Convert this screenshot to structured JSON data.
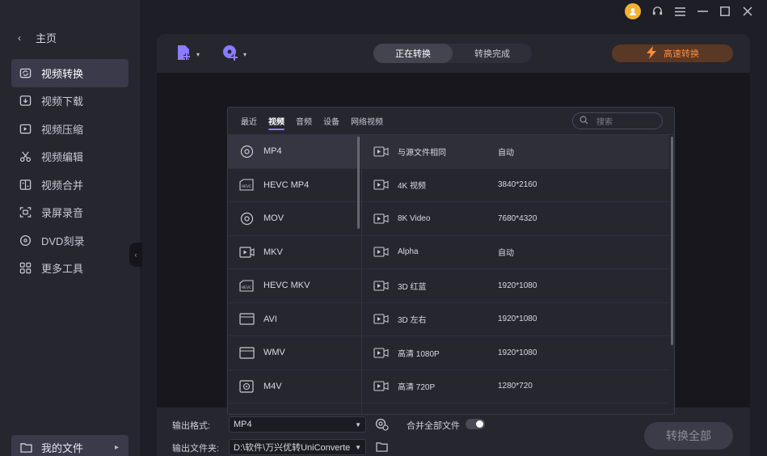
{
  "sidebar": {
    "home_label": "主页",
    "items": [
      {
        "label": "视频转换",
        "icon": "video-convert-icon"
      },
      {
        "label": "视频下载",
        "icon": "download-icon"
      },
      {
        "label": "视频压缩",
        "icon": "compress-icon"
      },
      {
        "label": "视频编辑",
        "icon": "scissors-icon"
      },
      {
        "label": "视频合并",
        "icon": "merge-icon"
      },
      {
        "label": "录屏录音",
        "icon": "screen-record-icon"
      },
      {
        "label": "DVD刻录",
        "icon": "disc-icon"
      },
      {
        "label": "更多工具",
        "icon": "grid-icon"
      }
    ],
    "my_files_label": "我的文件"
  },
  "header": {
    "tab_converting": "正在转换",
    "tab_done": "转换完成",
    "fast_convert": "高速转换"
  },
  "dialog": {
    "tabs": [
      "最近",
      "视频",
      "音频",
      "设备",
      "网络视频"
    ],
    "active_tab": "视频",
    "search_placeholder": "搜索",
    "formats": [
      "MP4",
      "HEVC MP4",
      "MOV",
      "MKV",
      "HEVC MKV",
      "AVI",
      "WMV",
      "M4V"
    ],
    "presets": [
      {
        "name": "与源文件相同",
        "res": "自动"
      },
      {
        "name": "4K 视频",
        "res": "3840*2160"
      },
      {
        "name": "8K Video",
        "res": "7680*4320"
      },
      {
        "name": "Alpha",
        "res": "自动"
      },
      {
        "name": "3D 红蓝",
        "res": "1920*1080"
      },
      {
        "name": "3D 左右",
        "res": "1920*1080"
      },
      {
        "name": "高清 1080P",
        "res": "1920*1080"
      },
      {
        "name": "高清 720P",
        "res": "1280*720"
      }
    ]
  },
  "bottom": {
    "output_format_label": "输出格式:",
    "output_format_value": "MP4",
    "merge_label": "合并全部文件",
    "output_folder_label": "输出文件夹:",
    "output_folder_value": "D:\\软件\\万兴优转UniConverte",
    "convert_all": "转换全部"
  },
  "colors": {
    "accent": "#8a7cff",
    "fast_orange": "#ff8c3a",
    "avatar": "#f2b233"
  }
}
